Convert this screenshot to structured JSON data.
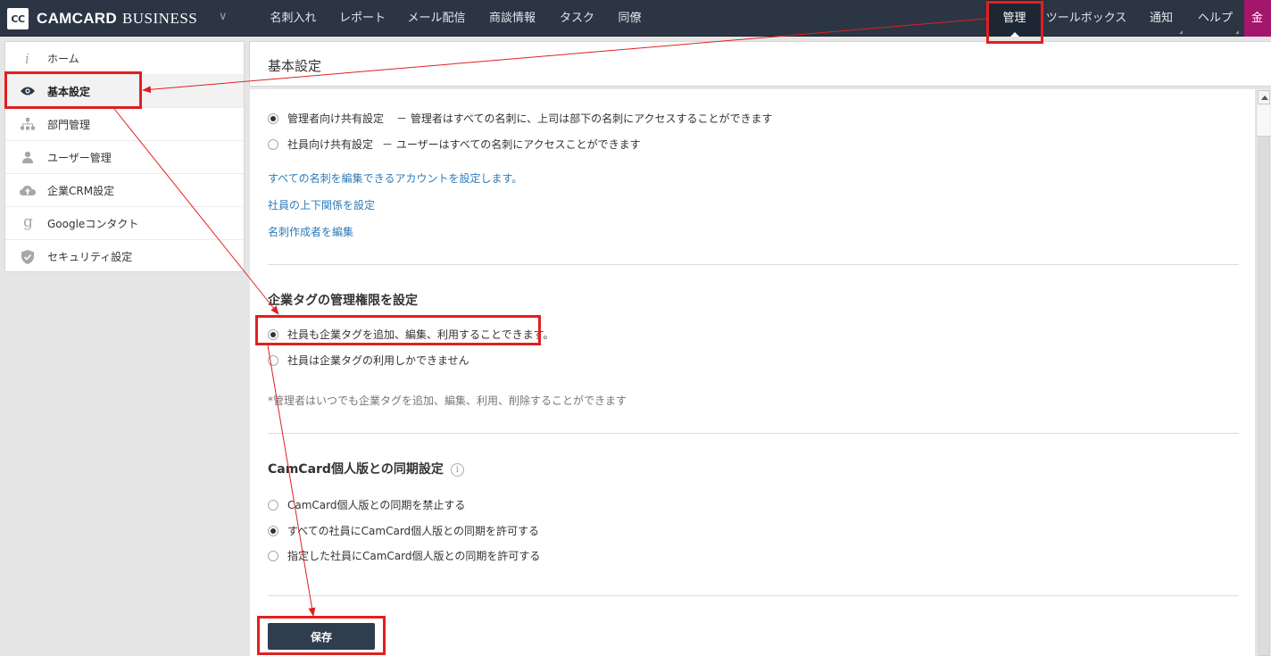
{
  "header": {
    "logo_mark": "CC",
    "logo_cam": "CAMCARD",
    "logo_biz": "BUSINESS",
    "logo_chevron": "∨",
    "nav": [
      {
        "label": "名刺入れ"
      },
      {
        "label": "レポート"
      },
      {
        "label": "メール配信"
      },
      {
        "label": "商談情報"
      },
      {
        "label": "タスク"
      },
      {
        "label": "同僚"
      },
      {
        "label": "管理"
      },
      {
        "label": "ツールボックス"
      },
      {
        "label": "通知"
      },
      {
        "label": "ヘルプ"
      }
    ],
    "avatar": "金"
  },
  "sidebar": {
    "items": [
      {
        "label": "ホーム",
        "icon": "info-icon"
      },
      {
        "label": "基本設定",
        "icon": "eye-icon"
      },
      {
        "label": "部門管理",
        "icon": "org-chart-icon"
      },
      {
        "label": "ユーザー管理",
        "icon": "user-icon"
      },
      {
        "label": "企業CRM設定",
        "icon": "cloud-upload-icon"
      },
      {
        "label": "Googleコンタクト",
        "icon": "google-icon"
      },
      {
        "label": "セキュリティ設定",
        "icon": "shield-icon"
      }
    ]
  },
  "main": {
    "title": "基本設定",
    "sharing": {
      "option1_label": "管理者向け共有設定",
      "option1_desc": "－ 管理者はすべての名刺に、上司は部下の名刺にアクセスすることができます",
      "option2_label": "社員向け共有設定",
      "option2_desc": "－ ユーザーはすべての名刺にアクセスことができます",
      "selected": 1
    },
    "links": [
      "すべての名刺を編集できるアカウントを設定します。",
      "社員の上下関係を設定",
      "名刺作成者を編集"
    ],
    "tags": {
      "title": "企業タグの管理権限を設定",
      "option1": "社員も企業タグを追加、編集、利用することできます。",
      "option2": "社員は企業タグの利用しかできません",
      "selected": 1,
      "note": "*管理者はいつでも企業タグを追加、編集、利用、削除することができます"
    },
    "sync": {
      "title": "CamCard個人版との同期設定",
      "info": "i",
      "option1": "CamCard個人版との同期を禁止する",
      "option2": "すべての社員にCamCard個人版との同期を許可する",
      "option3": "指定した社員にCamCard個人版との同期を許可する",
      "selected": 2
    },
    "save_label": "保存"
  },
  "colors": {
    "topbar": "#2b3544",
    "link": "#2e7ab8",
    "annotation": "#e02020",
    "avatar": "#a3166b",
    "save_button": "#2f3d4e"
  }
}
